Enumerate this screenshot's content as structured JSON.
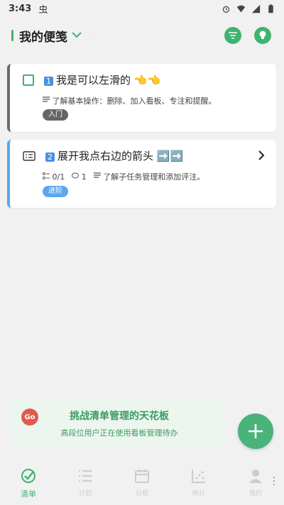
{
  "status": {
    "time": "3:43",
    "bug": "虫"
  },
  "header": {
    "title": "我的便笺"
  },
  "cards": [
    {
      "key": "1️⃣",
      "keycap_text": "1",
      "title": "我是可以左滑的",
      "hands": "👈👈",
      "meta": "了解基本操作：删除、加入看板、专注和提醒。",
      "tag": "入门"
    },
    {
      "keycap_text": "2",
      "title": "展开我点右边的箭头",
      "arrows": "➡️➡️",
      "subtasks": "0/1",
      "comments": "1",
      "meta": "了解子任务管理和添加评注。",
      "tag": "进阶"
    }
  ],
  "banner": {
    "badge": "Go",
    "title": "挑战清单管理的天花板",
    "subtitle": "高段位用户正在使用看板管理待办"
  },
  "nav": [
    {
      "label": "清单",
      "icon": "check-circle-icon",
      "active": true
    },
    {
      "label": "计划",
      "icon": "list-icon",
      "active": false
    },
    {
      "label": "日程",
      "icon": "calendar-icon",
      "active": false
    },
    {
      "label": "统计",
      "icon": "chart-icon",
      "active": false
    },
    {
      "label": "我的",
      "icon": "person-icon",
      "active": false
    }
  ],
  "colors": {
    "accent": "#3fb36f",
    "tag_beginner": "#666666",
    "tag_advanced": "#5aa8f0"
  }
}
